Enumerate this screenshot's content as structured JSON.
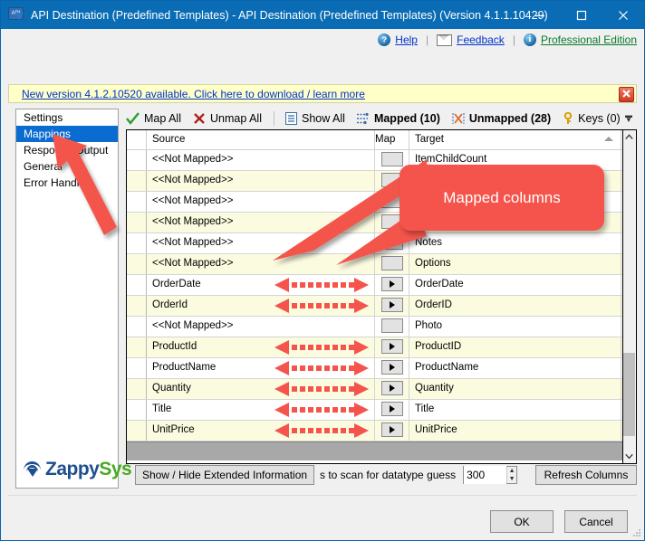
{
  "window": {
    "title": "API Destination (Predefined Templates) - API Destination (Predefined Templates) (Version 4.1.1.10429)",
    "icon": "api-icon",
    "minimize": "–",
    "maximize": "□",
    "close": "✕"
  },
  "helpbar": {
    "help": "Help",
    "feedback": "Feedback",
    "edition": "Professional Edition",
    "separator": "|"
  },
  "update_bar": {
    "message": "New version 4.1.2.10520 available. Click here to download / learn more",
    "close_label": "✕"
  },
  "sidebar": {
    "items": [
      {
        "label": "Settings",
        "selected": false
      },
      {
        "label": "Mappings",
        "selected": true
      },
      {
        "label": "Response Output",
        "selected": false
      },
      {
        "label": "General",
        "selected": false
      },
      {
        "label": "Error Handling",
        "selected": false
      }
    ],
    "logo": {
      "part1": "Zappy",
      "part2": "Sys"
    }
  },
  "toolbar": {
    "items": [
      {
        "label": "Map All",
        "icon": "check-icon",
        "bold": false
      },
      {
        "label": "Unmap All",
        "icon": "x-red-icon",
        "bold": false
      },
      {
        "label": "Show All",
        "icon": "list-icon",
        "bold": false
      },
      {
        "label": "Mapped (10)",
        "icon": "mapped-icon",
        "bold": true
      },
      {
        "label": "Unmapped (28)",
        "icon": "unmapped-icon",
        "bold": true
      },
      {
        "label": "Keys (0)",
        "icon": "key-icon",
        "bold": false
      }
    ]
  },
  "grid": {
    "columns": [
      "",
      "Source",
      "Map",
      "Target"
    ],
    "sort_column": "Target",
    "sort_direction": "asc",
    "rows": [
      {
        "source": "<<Not Mapped>>",
        "mapped": false,
        "target": "ItemChildCount"
      },
      {
        "source": "<<Not Mapped>>",
        "mapped": false,
        "target": ""
      },
      {
        "source": "<<Not Mapped>>",
        "mapped": false,
        "target": ""
      },
      {
        "source": "<<Not Mapped>>",
        "mapped": false,
        "target": ""
      },
      {
        "source": "<<Not Mapped>>",
        "mapped": false,
        "target": "Notes"
      },
      {
        "source": "<<Not Mapped>>",
        "mapped": false,
        "target": "Options"
      },
      {
        "source": "OrderDate",
        "mapped": true,
        "target": "OrderDate"
      },
      {
        "source": "OrderId",
        "mapped": true,
        "target": "OrderID"
      },
      {
        "source": "<<Not Mapped>>",
        "mapped": false,
        "target": "Photo"
      },
      {
        "source": "ProductId",
        "mapped": true,
        "target": "ProductID"
      },
      {
        "source": "ProductName",
        "mapped": true,
        "target": "ProductName"
      },
      {
        "source": "Quantity",
        "mapped": true,
        "target": "Quantity"
      },
      {
        "source": "Title",
        "mapped": true,
        "target": "Title"
      },
      {
        "source": "UnitPrice",
        "mapped": true,
        "target": "UnitPrice"
      }
    ]
  },
  "bottom": {
    "extended_info_label": "Show / Hide Extended Information",
    "scan_label": "s to scan for datatype guess",
    "scan_value": "300",
    "refresh_label": "Refresh Columns",
    "ok_label": "OK",
    "cancel_label": "Cancel"
  },
  "annotations": {
    "callout_text": "Mapped columns",
    "callout_color": "#f4544b",
    "arrow_color": "#f4544b"
  }
}
